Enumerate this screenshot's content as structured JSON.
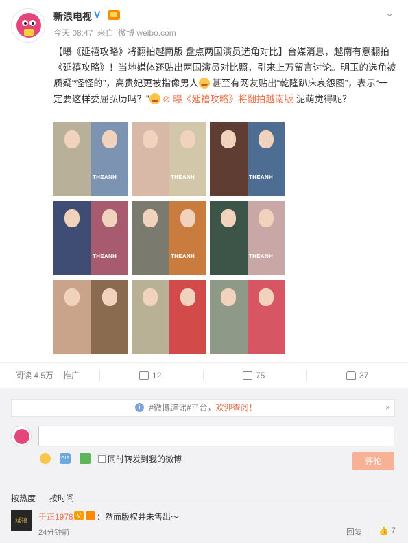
{
  "post": {
    "author": "新浪电视",
    "time": "今天 08:47",
    "from_label": "来自",
    "source": "微博 weibo.com",
    "text_parts": {
      "title": "【曝《延禧攻略》将翻拍越南版 盘点两国演员选角对比】",
      "body1": "台媒消息，越南有意翻拍《延禧攻略》！当地媒体还贴出两国演员对比照，引来上万留言讨论。明玉的选角被质疑“怪怪的”，高贵妃更被指像男人",
      "body2": " 甚至有网友贴出“乾隆趴床哀怨图”，表示“一定要这样委屈弘历吗？”",
      "link": "曝《延禧攻略》将翻拍越南版",
      "tail": " 泥萌觉得呢？"
    },
    "watermark": "THEANH",
    "grid_colors": [
      [
        "#b9b09a",
        "#7c93b1"
      ],
      [
        "#d8b8a6",
        "#d2c7a8"
      ],
      [
        "#5f3d32",
        "#4d6d92"
      ],
      [
        "#3f4d74",
        "#a85a6e"
      ],
      [
        "#7a7a6e",
        "#c97c3d"
      ],
      [
        "#3d5548",
        "#c9a7a7"
      ],
      [
        "#c9a38a",
        "#8b6b4f"
      ],
      [
        "#b8b196",
        "#d24a4a"
      ],
      [
        "#8e9a87",
        "#d75664"
      ]
    ]
  },
  "actions": {
    "read_label": "阅读",
    "read_count": "4.5万",
    "promote": "推广",
    "repost": "12",
    "comment": "75",
    "like": "37"
  },
  "notice": {
    "text": "#微博辟谣#平台，",
    "welcome": "欢迎查阅！",
    "close": "×"
  },
  "composer": {
    "gif_label": "GIF",
    "sync_label": "同时转发到我的微博",
    "submit": "评论"
  },
  "tabs": {
    "hot": "按热度",
    "time": "按时间"
  },
  "comment": {
    "avatar_text": "延禧",
    "author": "于正1978",
    "vbadge": "V",
    "text": "：然而版权并未售出～",
    "time": "24分钟前",
    "reply": "回复",
    "likes": "7"
  }
}
